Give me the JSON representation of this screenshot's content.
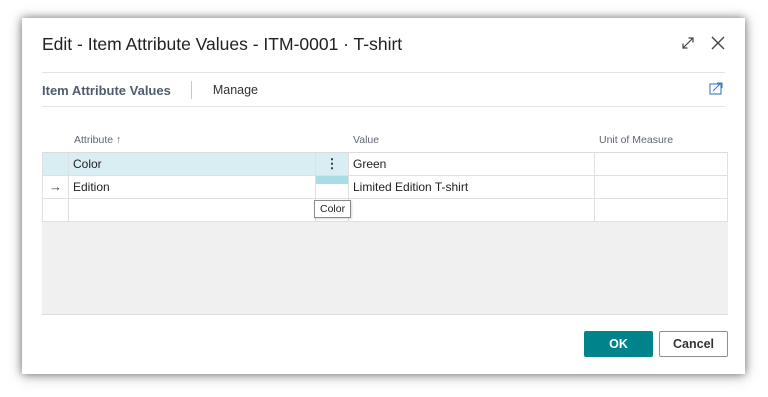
{
  "dialog": {
    "title": "Edit - Item Attribute Values - ITM-0001 · T-shirt"
  },
  "toolbar": {
    "main_tab": "Item Attribute Values",
    "manage": "Manage"
  },
  "grid": {
    "columns": {
      "attribute": "Attribute ↑",
      "value": "Value",
      "unit_of_measure": "Unit of Measure"
    },
    "rows": [
      {
        "marker": "",
        "attribute": "Color",
        "value": "Green",
        "unit_of_measure": ""
      },
      {
        "marker": "→",
        "attribute": "Edition",
        "value": "Limited Edition T-shirt",
        "unit_of_measure": ""
      },
      {
        "marker": "",
        "attribute": "",
        "value": "",
        "unit_of_measure": ""
      }
    ],
    "row_menu_glyph": "⋮"
  },
  "tooltip": {
    "text": "Color"
  },
  "buttons": {
    "ok": "OK",
    "cancel": "Cancel"
  },
  "colors": {
    "accent": "#00838a",
    "selected_row": "#d8eef3"
  },
  "icons": {
    "expand": "expand-icon",
    "close": "close-icon",
    "share": "share-icon",
    "row_menu": "more-vertical-icon",
    "row_arrow": "arrow-right-icon"
  }
}
